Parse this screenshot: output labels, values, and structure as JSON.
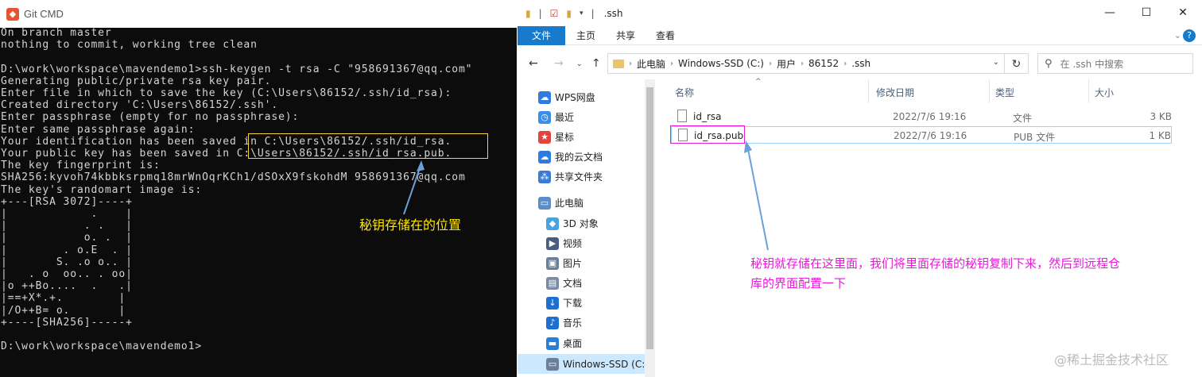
{
  "cmd": {
    "title": "Git CMD",
    "lines": [
      "On branch master",
      "nothing to commit, working tree clean",
      "",
      "D:\\work\\workspace\\mavendemo1>ssh-keygen -t rsa -C \"958691367@qq.com\"",
      "Generating public/private rsa key pair.",
      "Enter file in which to save the key (C:\\Users\\86152/.ssh/id_rsa):",
      "Created directory 'C:\\Users\\86152/.ssh'.",
      "Enter passphrase (empty for no passphrase):",
      "Enter same passphrase again:",
      "Your identification has been saved in C:\\Users\\86152/.ssh/id_rsa.",
      "Your public key has been saved in C:\\Users\\86152/.ssh/id_rsa.pub.",
      "The key fingerprint is:",
      "SHA256:kyvoh74kbbksrpmq18mrWnOqrKCh1/dSOxX9fskohdM 958691367@qq.com",
      "The key's randomart image is:",
      "+---[RSA 3072]----+",
      "|            .    |",
      "|           . .   |",
      "|           o. .  |",
      "|        . o.E  . |",
      "|       S. .o o.. |",
      "|   . o  oo.. . oo|",
      "|o ++Bo....  .   .|",
      "|==+X*.+.        |",
      "|/O++B= o.       |",
      "+----[SHA256]-----+",
      "",
      "D:\\work\\workspace\\mavendemo1>"
    ],
    "annotation": "秘钥存储在的位置"
  },
  "explorer": {
    "title": ".ssh",
    "window_controls": {
      "minimize": "—",
      "maximize": "☐",
      "close": "✕"
    },
    "ribbon_tabs": [
      "文件",
      "主页",
      "共享",
      "查看"
    ],
    "address_segments": [
      "此电脑",
      "Windows-SSD (C:)",
      "用户",
      "86152",
      ".ssh"
    ],
    "search_placeholder": "在 .ssh 中搜索",
    "nav_items": [
      {
        "label": "WPS网盘",
        "icon": "cloud-icon",
        "color": "#2f7be0"
      },
      {
        "label": "最近",
        "icon": "clock-icon",
        "color": "#3a8ee6"
      },
      {
        "label": "星标",
        "icon": "star-icon",
        "color": "#e0443c"
      },
      {
        "label": "我的云文档",
        "icon": "cloud-doc-icon",
        "color": "#2f7be0"
      },
      {
        "label": "共享文件夹",
        "icon": "share-folder-icon",
        "color": "#3a7bd5"
      },
      {
        "label": "此电脑",
        "icon": "computer-icon",
        "color": "#5b8ec9"
      },
      {
        "label": "3D 对象",
        "icon": "cube-icon",
        "color": "#4aa3df"
      },
      {
        "label": "视频",
        "icon": "video-icon",
        "color": "#4a5d7e"
      },
      {
        "label": "图片",
        "icon": "picture-icon",
        "color": "#6b7f99"
      },
      {
        "label": "文档",
        "icon": "document-icon",
        "color": "#7a8ba3"
      },
      {
        "label": "下载",
        "icon": "download-icon",
        "color": "#1f6fd1"
      },
      {
        "label": "音乐",
        "icon": "music-icon",
        "color": "#1f6fd1"
      },
      {
        "label": "桌面",
        "icon": "desktop-icon",
        "color": "#2a7fd4"
      },
      {
        "label": "Windows-SSD (C:",
        "icon": "drive-icon",
        "color": "#6b7f99"
      }
    ],
    "columns": [
      "名称",
      "修改日期",
      "类型",
      "大小"
    ],
    "files": [
      {
        "name": "id_rsa",
        "date": "2022/7/6 19:16",
        "type": "文件",
        "size": "3 KB"
      },
      {
        "name": "id_rsa.pub",
        "date": "2022/7/6 19:16",
        "type": "PUB 文件",
        "size": "1 KB"
      }
    ],
    "annotation": "秘钥就存储在这里面，我们将里面存储的秘钥复制下来，然后到远程仓库的界面配置一下",
    "watermark": "@稀土掘金技术社区"
  }
}
